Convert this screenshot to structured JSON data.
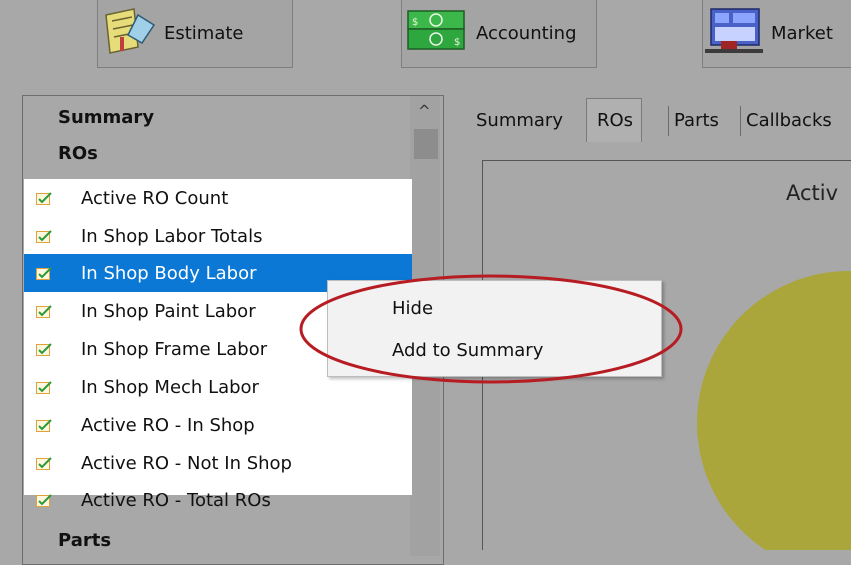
{
  "toolbar": {
    "estimate_label": "Estimate",
    "accounting_label": "Accounting",
    "marketing_label": "Market"
  },
  "sidebar": {
    "group_summary": "Summary",
    "group_ros": "ROs",
    "group_parts": "Parts",
    "items": [
      {
        "label": "Active RO Count",
        "checked": true
      },
      {
        "label": "In Shop Labor Totals",
        "checked": true
      },
      {
        "label": "In Shop Body Labor",
        "checked": true,
        "selected": true
      },
      {
        "label": "In Shop Paint Labor",
        "checked": true
      },
      {
        "label": "In Shop Frame Labor",
        "checked": true
      },
      {
        "label": "In Shop Mech Labor",
        "checked": true
      },
      {
        "label": "Active RO - In Shop",
        "checked": true
      },
      {
        "label": "Active RO - Not In Shop",
        "checked": true
      },
      {
        "label": "Active RO - Total ROs",
        "checked": true
      }
    ]
  },
  "tabs": [
    {
      "label": "Summary"
    },
    {
      "label": "ROs",
      "active": true
    },
    {
      "label": "Parts"
    },
    {
      "label": "Callbacks"
    }
  ],
  "chart": {
    "title": "Activ",
    "pie_color": "#aaa63c"
  },
  "context_menu": {
    "items": [
      {
        "label": "Hide"
      },
      {
        "label": "Add to Summary"
      }
    ]
  },
  "colors": {
    "selection": "#0b78d6",
    "annotation": "#b71c22"
  }
}
